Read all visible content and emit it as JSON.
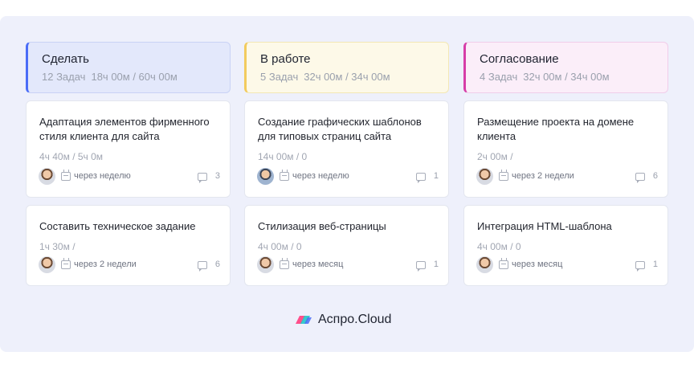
{
  "columns": [
    {
      "title": "Сделать",
      "tasks_count": "12 Задач",
      "time": "18ч 00м / 60ч 00м",
      "accent": "#4a6cf7",
      "bg": "#e3e8fb",
      "border": "#c9d2f5",
      "cards": [
        {
          "title": "Адаптация элементов фирменного стиля клиента для сайта",
          "time": "4ч 40м / 5ч 0м",
          "due": "через неделю",
          "comments": "3"
        },
        {
          "title": "Составить техническое задание",
          "time": "1ч 30м /",
          "due": "через 2 недели",
          "comments": "6"
        }
      ]
    },
    {
      "title": "В работе",
      "tasks_count": "5 Задач",
      "time": "32ч 00м / 34ч 00м",
      "accent": "#f2cb5e",
      "bg": "#fdf9e8",
      "border": "#f3e7b4",
      "cards": [
        {
          "title": "Создание графических шаблонов для типовых страниц сайта",
          "time": "14ч 00м / 0",
          "due": "через неделю",
          "comments": "1"
        },
        {
          "title": "Стилизация веб-страницы",
          "time": "4ч 00м / 0",
          "due": "через месяц",
          "comments": "1"
        }
      ]
    },
    {
      "title": "Согласование",
      "tasks_count": "4 Задач",
      "time": "32ч 00м / 34ч 00м",
      "accent": "#d63ea8",
      "bg": "#fbeef9",
      "border": "#f0cdea",
      "cards": [
        {
          "title": "Размещение проекта на домене клиента",
          "time": "2ч 00м /",
          "due": "через 2 недели",
          "comments": "6"
        },
        {
          "title": "Интеграция HTML-шаблона",
          "time": "4ч 00м / 0",
          "due": "через месяц",
          "comments": "1"
        }
      ]
    }
  ],
  "brand": {
    "name": "Аспро.Cloud",
    "colors": [
      "#ff4f8b",
      "#22c7c7",
      "#4a6cf7"
    ]
  }
}
